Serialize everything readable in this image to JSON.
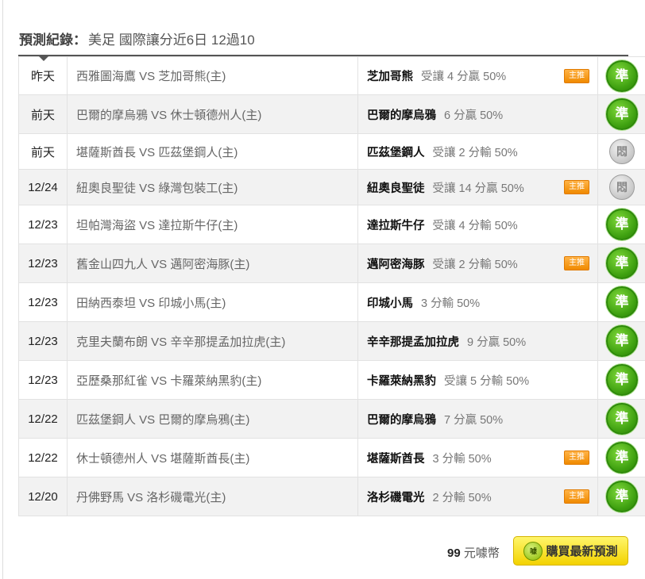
{
  "header": {
    "label": "預測紀錄：",
    "description": "美足 國際讓分近6日 12過10"
  },
  "rows": [
    {
      "date": "昨天",
      "match": "西雅圖海鷹 VS 芝加哥熊(主)",
      "pick_team": "芝加哥熊",
      "pick_detail": "受讓 4 分贏 50%",
      "tag": "主推",
      "result": "準",
      "result_type": "win"
    },
    {
      "date": "前天",
      "match": "巴爾的摩烏鴉 VS 休士頓德州人(主)",
      "pick_team": "巴爾的摩烏鴉",
      "pick_detail": "6 分贏 50%",
      "tag": "",
      "result": "準",
      "result_type": "win"
    },
    {
      "date": "前天",
      "match": "堪薩斯酋長 VS 匹茲堡鋼人(主)",
      "pick_team": "匹茲堡鋼人",
      "pick_detail": "受讓 2 分輸 50%",
      "tag": "",
      "result": "悶",
      "result_type": "push"
    },
    {
      "date": "12/24",
      "match": "紐奧良聖徒 VS 綠灣包裝工(主)",
      "pick_team": "紐奧良聖徒",
      "pick_detail": "受讓 14 分贏 50%",
      "tag": "主推",
      "result": "悶",
      "result_type": "push"
    },
    {
      "date": "12/23",
      "match": "坦帕灣海盜 VS 達拉斯牛仔(主)",
      "pick_team": "達拉斯牛仔",
      "pick_detail": "受讓 4 分輸 50%",
      "tag": "",
      "result": "準",
      "result_type": "win"
    },
    {
      "date": "12/23",
      "match": "舊金山四九人 VS 邁阿密海豚(主)",
      "pick_team": "邁阿密海豚",
      "pick_detail": "受讓 2 分輸 50%",
      "tag": "主推",
      "result": "準",
      "result_type": "win"
    },
    {
      "date": "12/23",
      "match": "田納西泰坦 VS 印城小馬(主)",
      "pick_team": "印城小馬",
      "pick_detail": "3 分輸 50%",
      "tag": "",
      "result": "準",
      "result_type": "win"
    },
    {
      "date": "12/23",
      "match": "克里夫蘭布朗 VS 辛辛那提孟加拉虎(主)",
      "pick_team": "辛辛那提孟加拉虎",
      "pick_detail": "9 分贏 50%",
      "tag": "",
      "result": "準",
      "result_type": "win"
    },
    {
      "date": "12/23",
      "match": "亞歷桑那紅雀 VS 卡羅萊納黑豹(主)",
      "pick_team": "卡羅萊納黑豹",
      "pick_detail": "受讓 5 分輸 50%",
      "tag": "",
      "result": "準",
      "result_type": "win"
    },
    {
      "date": "12/22",
      "match": "匹茲堡鋼人 VS 巴爾的摩烏鴉(主)",
      "pick_team": "巴爾的摩烏鴉",
      "pick_detail": "7 分贏 50%",
      "tag": "",
      "result": "準",
      "result_type": "win"
    },
    {
      "date": "12/22",
      "match": "休士頓德州人 VS 堪薩斯酋長(主)",
      "pick_team": "堪薩斯酋長",
      "pick_detail": "3 分輸 50%",
      "tag": "主推",
      "result": "準",
      "result_type": "win"
    },
    {
      "date": "12/20",
      "match": "丹佛野馬 VS 洛杉磯電光(主)",
      "pick_team": "洛杉磯電光",
      "pick_detail": "2 分輸 50%",
      "tag": "主推",
      "result": "準",
      "result_type": "win"
    }
  ],
  "footer": {
    "price_value": "99",
    "price_unit": "元噱幣",
    "coin_glyph": "噱",
    "buy_label": "購買最新預測"
  },
  "colors": {
    "win": "#3ea010",
    "push": "#c7c7c7",
    "tag": "#f08a00",
    "buy": "#f3d200"
  }
}
